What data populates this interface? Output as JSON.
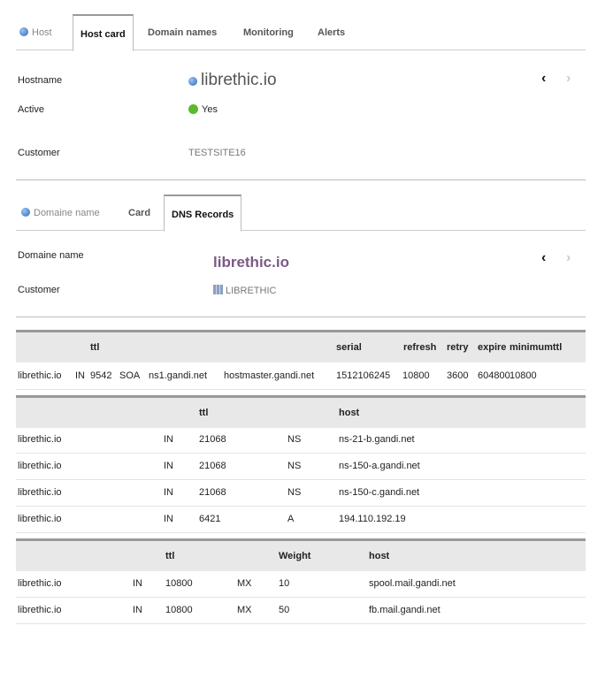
{
  "host_tabs": [
    "Host",
    "Host card",
    "Domain names",
    "Monitoring",
    "Alerts"
  ],
  "host_card": {
    "hostname_label": "Hostname",
    "hostname": "librethic.io",
    "active_label": "Active",
    "active": "Yes",
    "customer_label": "Customer",
    "customer": "TESTSITE16"
  },
  "domain_tabs": [
    "Domaine name",
    "Card",
    "DNS Records"
  ],
  "domain_card": {
    "domain_label": "Domaine name",
    "domain": "librethic.io",
    "customer_label": "Customer",
    "customer": "LIBRETHIC"
  },
  "soa": {
    "headers": [
      "ttl",
      "serial",
      "refresh",
      "retry",
      "expire",
      "minimumttl"
    ],
    "row": [
      "librethic.io",
      "IN",
      "9542",
      "SOA",
      "ns1.gandi.net",
      "hostmaster.gandi.net",
      "1512106245",
      "10800",
      "3600",
      "604800",
      "10800"
    ]
  },
  "ns": {
    "headers": [
      "ttl",
      "host"
    ],
    "rows": [
      [
        "librethic.io",
        "IN",
        "21068",
        "NS",
        "ns-21-b.gandi.net"
      ],
      [
        "librethic.io",
        "IN",
        "21068",
        "NS",
        "ns-150-a.gandi.net"
      ],
      [
        "librethic.io",
        "IN",
        "21068",
        "NS",
        "ns-150-c.gandi.net"
      ],
      [
        "librethic.io",
        "IN",
        "6421",
        "A",
        "194.110.192.19"
      ]
    ]
  },
  "mx": {
    "headers": [
      "ttl",
      "Weight",
      "host"
    ],
    "rows": [
      [
        "librethic.io",
        "IN",
        "10800",
        "MX",
        "10",
        "spool.mail.gandi.net"
      ],
      [
        "librethic.io",
        "IN",
        "10800",
        "MX",
        "50",
        "fb.mail.gandi.net"
      ]
    ]
  },
  "colors": {
    "domain": "#7a5a86",
    "active": "#5cb82e"
  }
}
